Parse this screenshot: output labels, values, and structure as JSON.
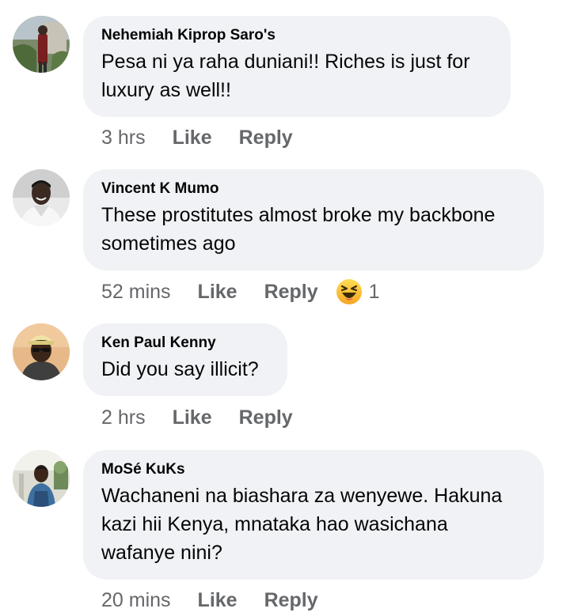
{
  "comments": [
    {
      "author": "Nehemiah Kiprop Saro's",
      "text": "Pesa ni ya raha duniani!! Riches is just for luxury as well!!",
      "time": "3 hrs",
      "like_label": "Like",
      "reply_label": "Reply"
    },
    {
      "author": "Vincent K Mumo",
      "text": "These prostitutes almost broke my backbone sometimes ago",
      "time": "52 mins",
      "like_label": "Like",
      "reply_label": "Reply",
      "reaction": {
        "icon": "haha-emoji-icon",
        "count": "1"
      }
    },
    {
      "author": "Ken Paul Kenny",
      "text": "Did you say illicit?",
      "time": "2 hrs",
      "like_label": "Like",
      "reply_label": "Reply"
    },
    {
      "author": "MoSé KuKs",
      "text": "Wachaneni na biashara za wenyewe. Hakuna kazi hii Kenya, mnataka hao wasichana wafanye nini?",
      "time": "20 mins",
      "like_label": "Like",
      "reply_label": "Reply"
    }
  ],
  "colors": {
    "bubble": "#f0f2f5",
    "meta_text": "#65676b",
    "body_text": "#050505"
  }
}
